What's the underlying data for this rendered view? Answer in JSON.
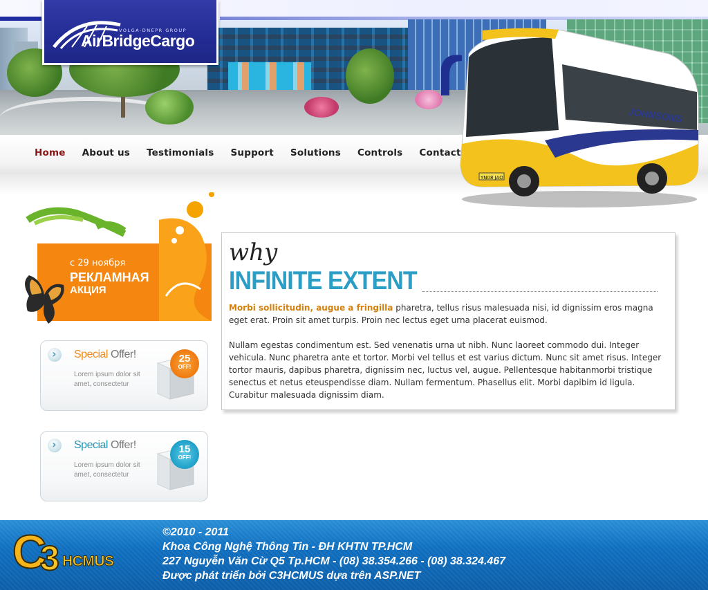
{
  "logo": {
    "tagline": "VOLGA-DNEPR GROUP",
    "name": "AirBridgeCargo"
  },
  "nav": {
    "items": [
      {
        "label": "Home",
        "active": true
      },
      {
        "label": "About us"
      },
      {
        "label": "Testimonials"
      },
      {
        "label": "Support"
      },
      {
        "label": "Solutions"
      },
      {
        "label": "Controls"
      },
      {
        "label": "Contact"
      }
    ],
    "active_color": "#8b1414"
  },
  "bus": {
    "brand": "JOHNSONS",
    "plate": "YN08 JAO"
  },
  "promo": {
    "line1": "с 29 ноября",
    "line2": "РЕКЛАМНАЯ",
    "line3": "АКЦИЯ"
  },
  "offers": [
    {
      "title_a": "Special",
      "title_b": "Offer!",
      "text": "Lorem ipsum dolor sit amet, consectetur",
      "percent": "25",
      "off": "OFF!",
      "color": "#f28a1a"
    },
    {
      "title_a": "Special",
      "title_b": "Offer!",
      "text": "Lorem ipsum dolor sit amet, consectetur",
      "percent": "15",
      "off": "OFF!",
      "color": "#2494b4"
    }
  ],
  "main": {
    "why": "why",
    "headline": "INFINITE EXTENT",
    "para1_highlight": "Morbi sollicitudin, augue a fringilla",
    "para1_rest": " pharetra, tellus risus malesuada nisi, id dignissim eros magna eget erat. Proin sit amet turpis. Proin nec lectus eget urna placerat euismod.",
    "para2": "Nullam egestas condimentum est. Sed venenatis urna ut nibh. Nunc laoreet commodo dui. Integer vehicula. Nunc pharetra ante et tortor. Morbi vel tellus et est varius dictum. Nunc sit amet risus. Integer tortor mauris, dapibus pharetra, dignissim nec, luctus vel, augue. Pellentesque habitanmorbi tristique senectus et netus eteuspendisse diam. Nullam fermentum. Phasellus elit. Morbi dapibim id ligula. Curabitur malesuada dignissim diam."
  },
  "footer": {
    "logo_c": "C",
    "logo_3": "3",
    "logo_text": "HCMUS",
    "lines": [
      "©2010 - 2011",
      "Khoa Công Nghệ Thông Tin - ĐH KHTN TP.HCM",
      "227 Nguyễn Văn Cừ Q5 Tp.HCM - (08) 38.354.266 - (08) 38.324.467",
      "Được phát triển bởi C3HCMUS dựa trên ASP.NET"
    ]
  }
}
